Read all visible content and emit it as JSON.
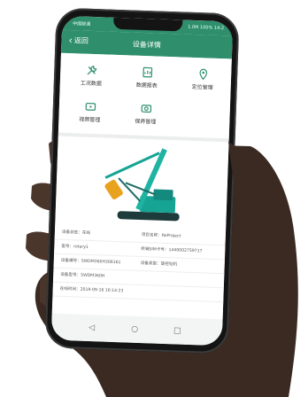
{
  "status": {
    "left": "中国联通",
    "right": "1.0M 100% 14:2"
  },
  "nav": {
    "back_label": "返回",
    "title": "设备详情"
  },
  "menu": [
    {
      "label": "工况数据",
      "icon": "wrench-icon"
    },
    {
      "label": "数据报表",
      "icon": "report-icon"
    },
    {
      "label": "定位管理",
      "icon": "location-pin-icon"
    },
    {
      "label": "视频管理",
      "icon": "video-icon"
    },
    {
      "label": "保养管理",
      "icon": "maintenance-icon"
    }
  ],
  "machine": {
    "image": "rotary-drilling-rig-image",
    "colors": {
      "body": "#16a495",
      "mast": "#1fb3a2",
      "bucket": "#e9a21d"
    }
  },
  "info": {
    "status": "设备状态：在线",
    "project": "项目名称：ReProject",
    "model_name": "型号：rotary1",
    "sim": "终端SIM卡号：1440002759717",
    "serial": "设备编号：SWDM360H306161",
    "type": "设备类型：旋挖钻机",
    "model_no": "设备型号：SWDM360H",
    "online_time": "在线时间：2019-09-16 10:14:23"
  },
  "softkeys": {
    "back": "◁",
    "home": "○",
    "recent": "□"
  },
  "theme": {
    "primary": "#2f8f6d",
    "accent": "#2f8f6d"
  }
}
